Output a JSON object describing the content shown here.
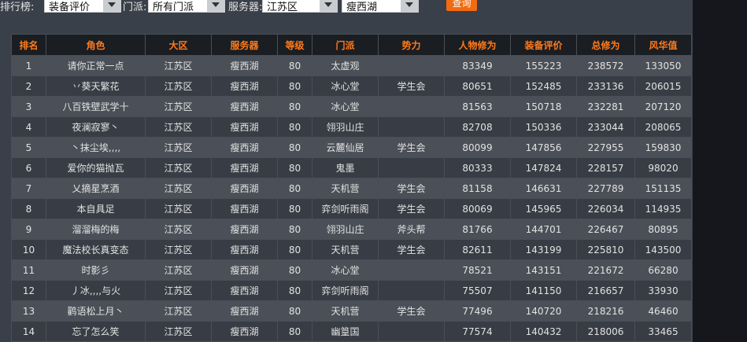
{
  "filters": {
    "ranking_label": "排行榜:",
    "ranking_value": "装备评价",
    "sect_label": "门派:",
    "sect_value": "所有门派",
    "server_label": "服务器:",
    "region_value": "江苏区",
    "server_value": "瘦西湖",
    "query_label": "查询"
  },
  "table": {
    "headers": [
      "排名",
      "角色",
      "大区",
      "服务器",
      "等级",
      "门派",
      "势力",
      "人物修为",
      "装备评价",
      "总修为",
      "风华值"
    ],
    "rows": [
      [
        "1",
        "请你正常一点",
        "江苏区",
        "瘦西湖",
        "80",
        "太虚观",
        "",
        "83349",
        "155223",
        "238572",
        "133050"
      ],
      [
        "2",
        "丷葵天繁花",
        "江苏区",
        "瘦西湖",
        "80",
        "冰心堂",
        "学生会",
        "80651",
        "152485",
        "233136",
        "206015"
      ],
      [
        "3",
        "八百铁壁武学十",
        "江苏区",
        "瘦西湖",
        "80",
        "冰心堂",
        "",
        "81563",
        "150718",
        "232281",
        "207120"
      ],
      [
        "4",
        "夜澜寂寥丶",
        "江苏区",
        "瘦西湖",
        "80",
        "翎羽山庄",
        "",
        "82708",
        "150336",
        "233044",
        "208065"
      ],
      [
        "5",
        "丶抹尘埃,,,,",
        "江苏区",
        "瘦西湖",
        "80",
        "云麓仙居",
        "学生会",
        "80099",
        "147856",
        "227955",
        "159830"
      ],
      [
        "6",
        "爱你的猫抛瓦",
        "江苏区",
        "瘦西湖",
        "80",
        "鬼墨",
        "",
        "80333",
        "147824",
        "228157",
        "98020"
      ],
      [
        "7",
        "乂摘星烹酒",
        "江苏区",
        "瘦西湖",
        "80",
        "天机营",
        "学生会",
        "81158",
        "146631",
        "227789",
        "151135"
      ],
      [
        "8",
        "本自具足",
        "江苏区",
        "瘦西湖",
        "80",
        "弈剑听雨阁",
        "学生会",
        "80069",
        "145965",
        "226034",
        "114935"
      ],
      [
        "9",
        "溜溜梅的梅",
        "江苏区",
        "瘦西湖",
        "80",
        "翎羽山庄",
        "斧头帮",
        "81766",
        "144701",
        "226467",
        "80895"
      ],
      [
        "10",
        "魔法校长真变态",
        "江苏区",
        "瘦西湖",
        "80",
        "天机营",
        "学生会",
        "82611",
        "143199",
        "225810",
        "143500"
      ],
      [
        "11",
        "时影彡",
        "江苏区",
        "瘦西湖",
        "80",
        "冰心堂",
        "",
        "78521",
        "143151",
        "221672",
        "66280"
      ],
      [
        "12",
        "丿冰,,,,与火",
        "江苏区",
        "瘦西湖",
        "80",
        "弈剑听雨阁",
        "",
        "75507",
        "141150",
        "216657",
        "33930"
      ],
      [
        "13",
        "鹳语松上月丶",
        "江苏区",
        "瘦西湖",
        "80",
        "天机营",
        "学生会",
        "77496",
        "140720",
        "218216",
        "46460"
      ],
      [
        "14",
        "忘了怎么笑",
        "江苏区",
        "瘦西湖",
        "80",
        "幽篁国",
        "",
        "77574",
        "140432",
        "218006",
        "33465"
      ]
    ]
  }
}
